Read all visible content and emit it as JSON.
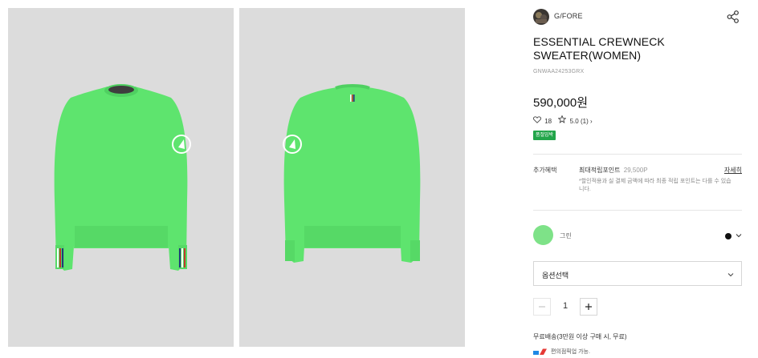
{
  "product": {
    "brand": "G/FORE",
    "title": "ESSENTIAL CREWNECK SWEATER(WOMEN)",
    "sku": "GNWAA24253GRX",
    "price": "590,000원",
    "likes": "18",
    "rating": "5.0",
    "review_count": "(1)",
    "review_arrow": "›",
    "badge": "품절임박"
  },
  "benefit": {
    "label": "추가혜택",
    "title": "최대적립포인트",
    "points": "29,500P",
    "detail_link": "자세히",
    "note": "*할인적용과 실 결제 금액에 따라 최종 적립 포인트는 다를 수 있습니다."
  },
  "color": {
    "name": "그린",
    "swatch_color": "#7ee288"
  },
  "option_select": {
    "label": "옵션선택"
  },
  "quantity": {
    "value": "1"
  },
  "shipping": {
    "text": "무료배송(3만원 이상 구매 시, 무료)"
  },
  "pickup": {
    "text": "편의점픽업 가능."
  },
  "images": [
    {
      "view": "front",
      "garment_color": "#5ee46e"
    },
    {
      "view": "back",
      "garment_color": "#5ee46e"
    }
  ],
  "icons": [
    "share-icon",
    "heart-icon",
    "star-icon",
    "chevron-down-icon",
    "minus-icon",
    "plus-icon"
  ]
}
